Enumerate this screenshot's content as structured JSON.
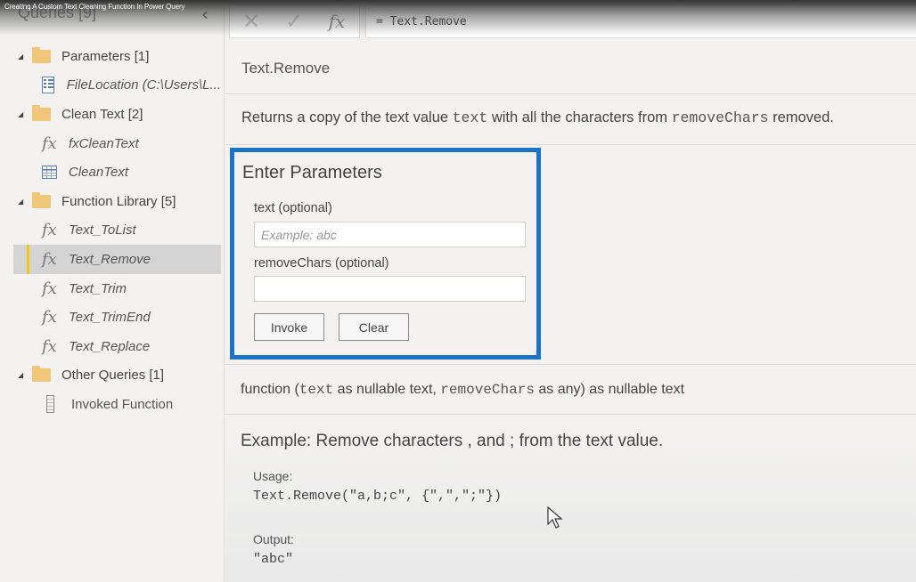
{
  "video": {
    "title": "Creating A Custom Text Cleaning Function In Power Query"
  },
  "sidebar": {
    "header": "Queries [9]",
    "collapse_icon": "chevron-left",
    "groups": [
      {
        "label": "Parameters [1]",
        "items": [
          {
            "label": "FileLocation (C:\\Users\\L...",
            "icon": "parameter-icon"
          }
        ]
      },
      {
        "label": "Clean Text [2]",
        "items": [
          {
            "label": "fxCleanText",
            "icon": "fx-icon"
          },
          {
            "label": "CleanText",
            "icon": "table-icon"
          }
        ]
      },
      {
        "label": "Function Library [5]",
        "items": [
          {
            "label": "Text_ToList",
            "icon": "fx-icon"
          },
          {
            "label": "Text_Remove",
            "icon": "fx-icon",
            "selected": true
          },
          {
            "label": "Text_Trim",
            "icon": "fx-icon"
          },
          {
            "label": "Text_TrimEnd",
            "icon": "fx-icon"
          },
          {
            "label": "Text_Replace",
            "icon": "fx-icon"
          }
        ]
      },
      {
        "label": "Other Queries [1]",
        "items": [
          {
            "label": "Invoked Function",
            "icon": "list-icon"
          }
        ]
      }
    ]
  },
  "formula_bar": {
    "cancel_glyph": "✕",
    "commit_glyph": "✓",
    "fx_glyph": "fx",
    "formula": "= Text.Remove"
  },
  "function": {
    "name": "Text.Remove",
    "description": {
      "part1": "Returns a copy of the text value ",
      "code1": "text",
      "part2": " with all the characters from ",
      "code2": "removeChars",
      "part3": " removed."
    },
    "parameters": {
      "title": "Enter Parameters",
      "fields": [
        {
          "label": "text (optional)",
          "placeholder": "Example: abc",
          "value": ""
        },
        {
          "label": "removeChars (optional)",
          "placeholder": "",
          "value": ""
        }
      ],
      "invoke_label": "Invoke",
      "clear_label": "Clear"
    },
    "signature": {
      "part1": "function (",
      "code1": "text",
      "part2": " as nullable text, ",
      "code2": "removeChars",
      "part3": " as any) as nullable text"
    },
    "example": {
      "title": "Example: Remove characters , and ; from the text value.",
      "usage_label": "Usage:",
      "usage_code": "Text.Remove(\"a,b;c\", {\",\",\";\"})",
      "output_label": "Output:",
      "output_code": "\"abc\""
    }
  },
  "colors": {
    "accent_blue": "#1a73c8",
    "selected_marker": "#f2c811",
    "folder": "#f0c778"
  }
}
